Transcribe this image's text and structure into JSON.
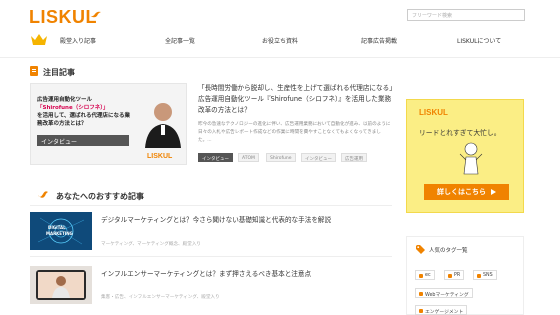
{
  "header": {
    "logo": "LISKUL",
    "search_placeholder": "フリーワード検索",
    "nav": [
      "殿堂入り記事",
      "全記事一覧",
      "お役立ち資料",
      "記事広告掲載",
      "LISKULについて"
    ]
  },
  "pickup": {
    "title": "注目記事",
    "image_text_line1": "広告運用自動化ツール",
    "image_text_red": "「Shirofune（シロフネ）」",
    "image_text_line2": "を活用して、選ばれる代理店になる業務改革の方法とは？",
    "image_badge": "インタビュー",
    "image_logo": "LISKUL",
    "article_title": "「長時間労働から脱却し、生産性を上げて選ばれる代理店になる」広告運用自動化ツール『Shirofune（シロフネ）』を活用した業務改革の方法とは？",
    "article_desc": "昨今の急速なテクノロジーの進化に伴い、広告運用業務において自動化が進み、以前のように日々の入札や広告レポート作成などの作業に時間を費やすことなくてもよくなってきました。...",
    "tags": [
      "インタビュー",
      "ATOM",
      "Shirofune",
      "インタビュー",
      "広告運用"
    ]
  },
  "recommend": {
    "title": "あなたへのおすすめ記事",
    "items": [
      {
        "title": "デジタルマーケティングとは？今さら聞けない基礎知識と代表的な手法を解説",
        "meta": "マーケティング、マーケティング概念、殿堂入り",
        "thumb_text": "DIGITAL MARKETING"
      },
      {
        "title": "インフルエンサーマーケティングとは？まず押さえるべき基本と注意点",
        "meta": "集客・広告、インフルエンサーマーケティング、殿堂入り",
        "thumb_text": ""
      }
    ]
  },
  "sidebar": {
    "ad_logo": "LISKUL",
    "ad_text": "リードとれすぎて大忙し。",
    "ad_button": "詳しくはこちら",
    "tag_title": "人気のタグ一覧",
    "tags": [
      "ec",
      "PR",
      "SNS",
      "Webマーケティング",
      "エンゲージメント"
    ]
  },
  "colors": {
    "accent": "#f08300",
    "ad_bg": "#fbee85",
    "red": "#d6004e"
  }
}
